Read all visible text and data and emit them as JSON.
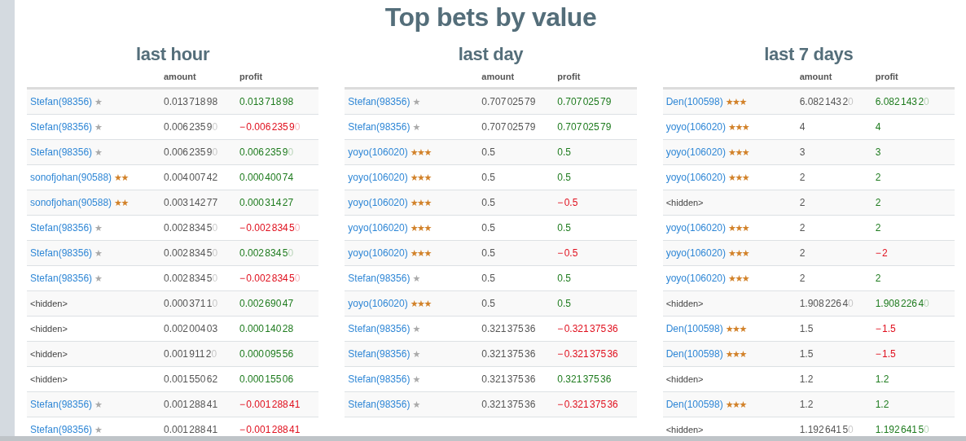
{
  "title": "Top bets by value",
  "panels": [
    {
      "title": "last hour",
      "columns": [
        "amount",
        "profit"
      ],
      "rows": [
        {
          "kind": "player",
          "user": "Stefan(98356)",
          "badge": "★",
          "color": "#aaaaaa",
          "amount": "0.013 718 98",
          "profit": "0.013 718 98",
          "negative": false
        },
        {
          "kind": "player",
          "user": "Stefan(98356)",
          "badge": "★",
          "color": "#aaaaaa",
          "amount": "0.006 235 9",
          "amount_pad": "0",
          "profit": "− 0.006 235 9",
          "profit_pad": "0",
          "negative": true
        },
        {
          "kind": "player",
          "user": "Stefan(98356)",
          "badge": "★",
          "color": "#aaaaaa",
          "amount": "0.006 235 9",
          "amount_pad": "0",
          "profit": "0.006 235 9",
          "profit_pad": "0",
          "negative": false
        },
        {
          "kind": "player",
          "user": "sonofjohan(90588)",
          "badge": "★★",
          "color": "#d2822a",
          "amount": "0.004 007 42",
          "profit": "0.000 400 74",
          "negative": false
        },
        {
          "kind": "player",
          "user": "sonofjohan(90588)",
          "badge": "★★",
          "color": "#d2822a",
          "amount": "0.003 142 77",
          "profit": "0.000 314 27",
          "negative": false
        },
        {
          "kind": "player",
          "user": "Stefan(98356)",
          "badge": "★",
          "color": "#aaaaaa",
          "amount": "0.002 834 5",
          "amount_pad": "0",
          "profit": "− 0.002 834 5",
          "profit_pad": "0",
          "negative": true
        },
        {
          "kind": "player",
          "user": "Stefan(98356)",
          "badge": "★",
          "color": "#aaaaaa",
          "amount": "0.002 834 5",
          "amount_pad": "0",
          "profit": "0.002 834 5",
          "profit_pad": "0",
          "negative": false
        },
        {
          "kind": "player",
          "user": "Stefan(98356)",
          "badge": "★",
          "color": "#aaaaaa",
          "amount": "0.002 834 5",
          "amount_pad": "0",
          "profit": "− 0.002 834 5",
          "profit_pad": "0",
          "negative": true
        },
        {
          "kind": "hidden",
          "user": "<hidden>",
          "amount": "0.000 371 1",
          "amount_pad": "0",
          "profit": "0.002 690 47",
          "negative": false
        },
        {
          "kind": "hidden",
          "user": "<hidden>",
          "amount": "0.002 004 03",
          "profit": "0.000 140 28",
          "negative": false
        },
        {
          "kind": "hidden",
          "user": "<hidden>",
          "amount": "0.001 911 2",
          "amount_pad": "0",
          "profit": "0.000 095 56",
          "negative": false
        },
        {
          "kind": "hidden",
          "user": "<hidden>",
          "amount": "0.001 550 62",
          "profit": "0.000 155 06",
          "negative": false
        },
        {
          "kind": "player",
          "user": "Stefan(98356)",
          "badge": "★",
          "color": "#aaaaaa",
          "amount": "0.001 288 41",
          "profit": "− 0.001 288 41",
          "negative": true
        },
        {
          "kind": "player",
          "user": "Stefan(98356)",
          "badge": "★",
          "color": "#aaaaaa",
          "amount": "0.001 288 41",
          "profit": "− 0.001 288 41",
          "negative": true
        }
      ]
    },
    {
      "title": "last day",
      "columns": [
        "amount",
        "profit"
      ],
      "rows": [
        {
          "kind": "player",
          "user": "Stefan(98356)",
          "badge": "★",
          "color": "#aaaaaa",
          "amount": "0.707 025 79",
          "profit": "0.707 025 79",
          "negative": false
        },
        {
          "kind": "player",
          "user": "Stefan(98356)",
          "badge": "★",
          "color": "#aaaaaa",
          "amount": "0.707 025 79",
          "profit": "0.707 025 79",
          "negative": false
        },
        {
          "kind": "player",
          "user": "yoyo(106020)",
          "badge": "★★★",
          "color": "#d2822a",
          "amount": "0.5",
          "profit": "0.5",
          "negative": false
        },
        {
          "kind": "player",
          "user": "yoyo(106020)",
          "badge": "★★★",
          "color": "#d2822a",
          "amount": "0.5",
          "profit": "0.5",
          "negative": false
        },
        {
          "kind": "player",
          "user": "yoyo(106020)",
          "badge": "★★★",
          "color": "#d2822a",
          "amount": "0.5",
          "profit": "− 0.5",
          "negative": true
        },
        {
          "kind": "player",
          "user": "yoyo(106020)",
          "badge": "★★★",
          "color": "#d2822a",
          "amount": "0.5",
          "profit": "0.5",
          "negative": false
        },
        {
          "kind": "player",
          "user": "yoyo(106020)",
          "badge": "★★★",
          "color": "#d2822a",
          "amount": "0.5",
          "profit": "− 0.5",
          "negative": true
        },
        {
          "kind": "player",
          "user": "Stefan(98356)",
          "badge": "★",
          "color": "#aaaaaa",
          "amount": "0.5",
          "profit": "0.5",
          "negative": false
        },
        {
          "kind": "player",
          "user": "yoyo(106020)",
          "badge": "★★★",
          "color": "#d2822a",
          "amount": "0.5",
          "profit": "0.5",
          "negative": false
        },
        {
          "kind": "player",
          "user": "Stefan(98356)",
          "badge": "★",
          "color": "#aaaaaa",
          "amount": "0.321 375 36",
          "profit": "− 0.321 375 36",
          "negative": true
        },
        {
          "kind": "player",
          "user": "Stefan(98356)",
          "badge": "★",
          "color": "#aaaaaa",
          "amount": "0.321 375 36",
          "profit": "− 0.321 375 36",
          "negative": true
        },
        {
          "kind": "player",
          "user": "Stefan(98356)",
          "badge": "★",
          "color": "#aaaaaa",
          "amount": "0.321 375 36",
          "profit": "0.321 375 36",
          "negative": false
        },
        {
          "kind": "player",
          "user": "Stefan(98356)",
          "badge": "★",
          "color": "#aaaaaa",
          "amount": "0.321 375 36",
          "profit": "− 0.321 375 36",
          "negative": true
        }
      ]
    },
    {
      "title": "last 7 days",
      "columns": [
        "amount",
        "profit"
      ],
      "rows": [
        {
          "kind": "player",
          "user": "Den(100598)",
          "badge": "★★★",
          "color": "#d2822a",
          "amount": "6.082 143 2",
          "amount_pad": "0",
          "profit": "6.082 143 2",
          "profit_pad": "0",
          "negative": false
        },
        {
          "kind": "player",
          "user": "yoyo(106020)",
          "badge": "★★★",
          "color": "#d2822a",
          "amount": "4",
          "profit": "4",
          "negative": false
        },
        {
          "kind": "player",
          "user": "yoyo(106020)",
          "badge": "★★★",
          "color": "#d2822a",
          "amount": "3",
          "profit": "3",
          "negative": false
        },
        {
          "kind": "player",
          "user": "yoyo(106020)",
          "badge": "★★★",
          "color": "#d2822a",
          "amount": "2",
          "profit": "2",
          "negative": false
        },
        {
          "kind": "hidden",
          "user": "<hidden>",
          "amount": "2",
          "profit": "2",
          "negative": false
        },
        {
          "kind": "player",
          "user": "yoyo(106020)",
          "badge": "★★★",
          "color": "#d2822a",
          "amount": "2",
          "profit": "2",
          "negative": false
        },
        {
          "kind": "player",
          "user": "yoyo(106020)",
          "badge": "★★★",
          "color": "#d2822a",
          "amount": "2",
          "profit": "− 2",
          "negative": true
        },
        {
          "kind": "player",
          "user": "yoyo(106020)",
          "badge": "★★★",
          "color": "#d2822a",
          "amount": "2",
          "profit": "2",
          "negative": false
        },
        {
          "kind": "hidden",
          "user": "<hidden>",
          "amount": "1.908 226 4",
          "amount_pad": "0",
          "profit": "1.908 226 4",
          "profit_pad": "0",
          "negative": false
        },
        {
          "kind": "player",
          "user": "Den(100598)",
          "badge": "★★★",
          "color": "#d2822a",
          "amount": "1.5",
          "profit": "− 1.5",
          "negative": true
        },
        {
          "kind": "player",
          "user": "Den(100598)",
          "badge": "★★★",
          "color": "#d2822a",
          "amount": "1.5",
          "profit": "− 1.5",
          "negative": true
        },
        {
          "kind": "hidden",
          "user": "<hidden>",
          "amount": "1.2",
          "profit": "1.2",
          "negative": false
        },
        {
          "kind": "player",
          "user": "Den(100598)",
          "badge": "★★★",
          "color": "#d2822a",
          "amount": "1.2",
          "profit": "1.2",
          "negative": false
        },
        {
          "kind": "hidden",
          "user": "<hidden>",
          "amount": "1.192 641 5",
          "amount_pad": "0",
          "profit": "1.192 641 5",
          "profit_pad": "0",
          "negative": false
        }
      ]
    }
  ]
}
